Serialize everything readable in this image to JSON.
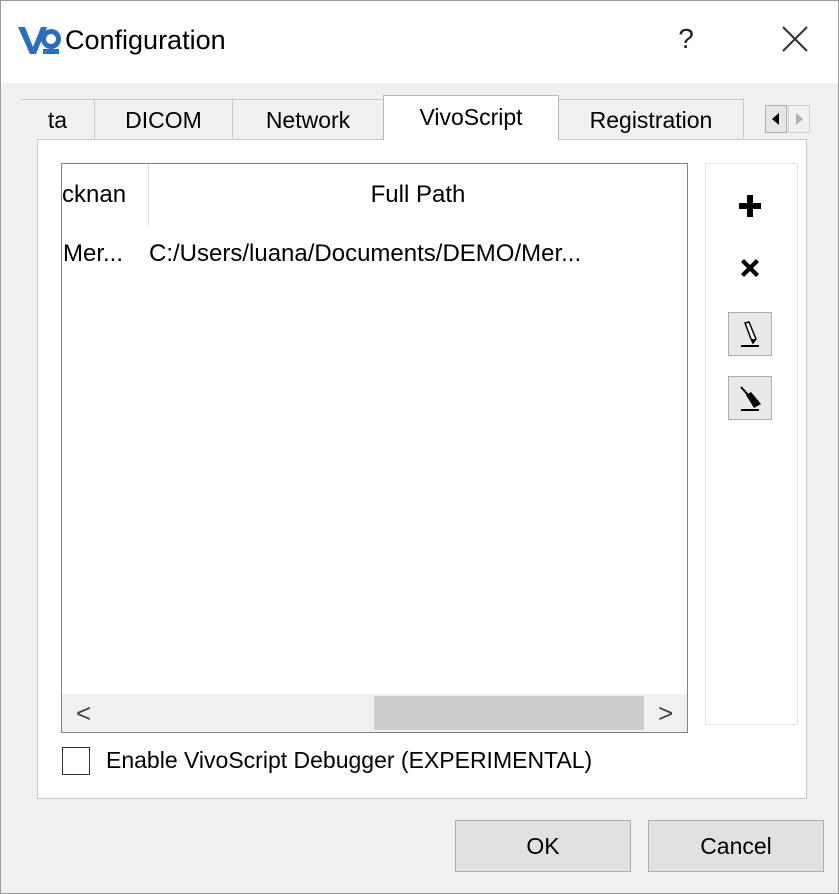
{
  "window": {
    "title": "Configuration",
    "help_label": "?",
    "close_icon": "close-icon",
    "app_icon": "vivoquant-logo-icon"
  },
  "tabs": [
    {
      "label": "ta",
      "active": false
    },
    {
      "label": "DICOM",
      "active": false
    },
    {
      "label": "Network",
      "active": false
    },
    {
      "label": "VivoScript",
      "active": true
    },
    {
      "label": "Registration",
      "active": false
    }
  ],
  "tab_scroll": {
    "left_icon": "triangle-left-icon",
    "right_icon": "triangle-right-icon"
  },
  "script_list": {
    "columns": [
      "cknan",
      "Full Path"
    ],
    "rows": [
      {
        "nickname": "Mer...",
        "full_path": "C:/Users/luana/Documents/DEMO/Mer..."
      }
    ],
    "scroll_left": "<",
    "scroll_right": ">"
  },
  "toolbar": {
    "add_icon": "plus-icon",
    "remove_icon": "x-icon",
    "edit_icon": "pencil-icon",
    "clear_icon": "broom-icon"
  },
  "debugger": {
    "label": "Enable VivoScript Debugger (EXPERIMENTAL)",
    "checked": false
  },
  "buttons": {
    "ok": "OK",
    "cancel": "Cancel"
  },
  "colors": {
    "logo_blue": "#2a6fbd",
    "panel_bg": "#ffffff",
    "window_bg": "#f0f0f0"
  }
}
